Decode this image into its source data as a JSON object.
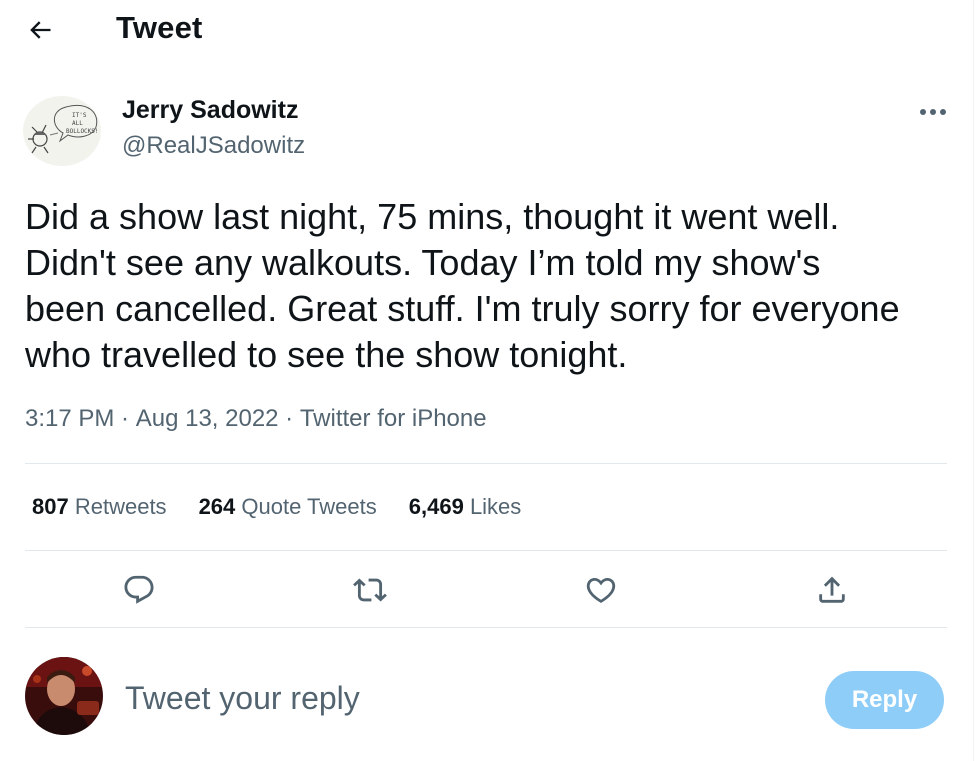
{
  "header": {
    "title": "Tweet",
    "back_icon": "arrow-left-icon"
  },
  "author": {
    "name": "Jerry Sadowitz",
    "handle": "@RealJSadowitz",
    "avatar_caption": "It's ALL BOLLOCKS!"
  },
  "tweet": {
    "text": "Did a show last night, 75 mins, thought it went well.\nDidn't see any walkouts. Today I’m told my show's\nbeen cancelled. Great stuff. I'm truly sorry for everyone\nwho travelled to see the show tonight.",
    "time": "3:17 PM",
    "separator": " · ",
    "date": "Aug 13, 2022",
    "source": "Twitter for iPhone"
  },
  "stats": {
    "retweets_count": "807",
    "retweets_label": "Retweets",
    "quotes_count": "264",
    "quotes_label": "Quote Tweets",
    "likes_count": "6,469",
    "likes_label": "Likes"
  },
  "actions": [
    "comment-icon",
    "retweet-icon",
    "like-icon",
    "share-icon"
  ],
  "reply": {
    "placeholder": "Tweet your reply",
    "button_label": "Reply"
  },
  "colors": {
    "text": "#0f1419",
    "secondary": "#536471",
    "divider": "#e1e8ed",
    "reply_button": "#8ecdf8"
  }
}
